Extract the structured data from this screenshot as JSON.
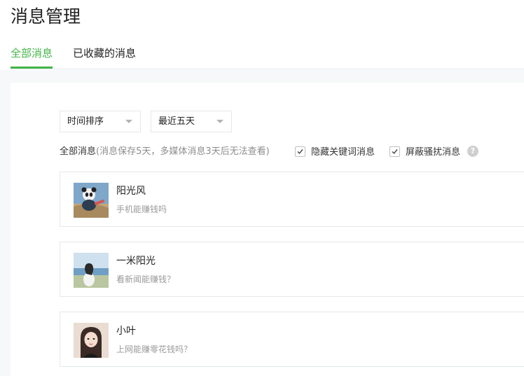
{
  "page": {
    "title": "消息管理"
  },
  "tabs": [
    {
      "label": "全部消息",
      "active": true
    },
    {
      "label": "已收藏的消息",
      "active": false
    }
  ],
  "filters": {
    "sort_select": {
      "value": "时间排序"
    },
    "range_select": {
      "value": "最近五天"
    },
    "summary_label": "全部消息",
    "summary_note": "(消息保存5天，多媒体消息3天后无法查看)",
    "hide_keyword": {
      "label": "隐藏关键词消息",
      "checked": true
    },
    "block_harass": {
      "label": "屏蔽骚扰消息",
      "checked": true
    },
    "help": "?"
  },
  "messages": [
    {
      "name": "阳光风",
      "text": "手机能赚钱吗",
      "avatar": "panda-avatar"
    },
    {
      "name": "一米阳光",
      "text": "看新闻能赚钱？",
      "avatar": "girl-seaside-avatar"
    },
    {
      "name": "小叶",
      "text": "上网能赚零花钱吗？",
      "avatar": "girl-portrait-avatar"
    }
  ],
  "colors": {
    "accent": "#44b549",
    "border": "#e4e8eb",
    "muted": "#9a9a9a",
    "background": "#f6f8f9"
  }
}
